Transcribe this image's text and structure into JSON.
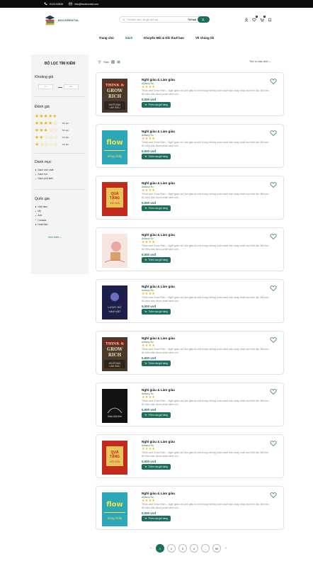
{
  "topbar": {
    "phone": "0123-52836",
    "email": "info@bookrental.com"
  },
  "header": {
    "logo_text": "BOOKRENTAL",
    "search_placeholder": "Tìm kiếm sách, tác giả, thể loại...",
    "search_category": "Thể loại",
    "wishlist_count": "0",
    "cart_count": "0"
  },
  "nav": [
    "Trang chủ",
    "Sách",
    "Khuyến Mãi & Dồi thuê bao",
    "Về chúng tôi"
  ],
  "sidebar": {
    "title": "BỘ LỌC TÌM KIẾM",
    "price_heading": "Khoảng giá",
    "price_from": "Từ",
    "price_to": "Đến",
    "rating_heading": "Đánh giá",
    "rating_labels": [
      "",
      "Trở lên",
      "Trở lên",
      "Trở lên",
      "Trở lên"
    ],
    "category_heading": "Danh mục",
    "categories": [
      "Sách mới nhất",
      "Sách hot",
      "Sách phổ biến"
    ],
    "country_heading": "Quốc gia",
    "countries": [
      "Việt Nam",
      "Mỹ",
      "Anh",
      "Canada",
      "Nhật Bản"
    ],
    "more": "Xem thêm"
  },
  "toolbar": {
    "filter_label": "Filter",
    "sort_label": "Thứ tự mặc định"
  },
  "product_template": {
    "title": "Nghĩ giàu & Làm giàu",
    "author": "Anthony Ru",
    "stars": "★★★★",
    "desc": "Think and Grow Rich – Nghĩ giàu và Làm giàu là một trong những cuốn sách bán chạy nhất mọi thời đại. Đã hơn 60 triệu bản được phát hành với...",
    "price": "5.000 vnđ",
    "button": "Thêm vào giỏ hàng"
  },
  "products": [
    {
      "cover": "grow-rich"
    },
    {
      "cover": "flow"
    },
    {
      "cover": "qua-tang"
    },
    {
      "cover": "pastel"
    },
    {
      "cover": "dark-blue"
    },
    {
      "cover": "grow-rich"
    },
    {
      "cover": "black"
    },
    {
      "cover": "qua-tang"
    },
    {
      "cover": "flow"
    }
  ],
  "pagination": [
    "1",
    "2",
    "3",
    "4",
    "...",
    "50"
  ],
  "colors": {
    "accent": "#1d6e5d",
    "star": "#f1b51c"
  }
}
